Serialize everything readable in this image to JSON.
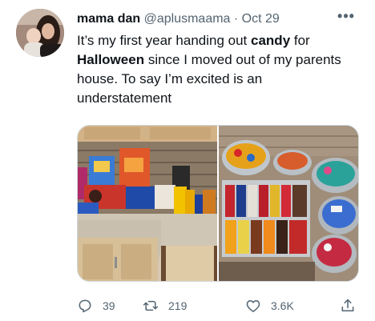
{
  "author": {
    "display_name": "mama dan",
    "handle": "@aplusmaama",
    "separator": "·",
    "date": "Oct 29",
    "avatar_icon": "profile-photo"
  },
  "more_icon": "more-horizontal-icon",
  "tweet": {
    "parts": [
      "It’s my first year handing out ",
      "candy",
      " for ",
      "Halloween",
      " since I moved out of my parents house. To say I’m excited is an understatement"
    ]
  },
  "media": {
    "photos": [
      "photo-candy-counter",
      "photo-candy-table"
    ]
  },
  "actions": {
    "reply": {
      "icon": "reply-icon",
      "count": "39"
    },
    "retweet": {
      "icon": "retweet-icon",
      "count": "219"
    },
    "like": {
      "icon": "heart-icon",
      "count": "3.6K"
    },
    "share": {
      "icon": "share-icon"
    }
  },
  "colors": {
    "text_primary": "#0f1419",
    "text_secondary": "#536471",
    "border": "#cfd9de"
  }
}
